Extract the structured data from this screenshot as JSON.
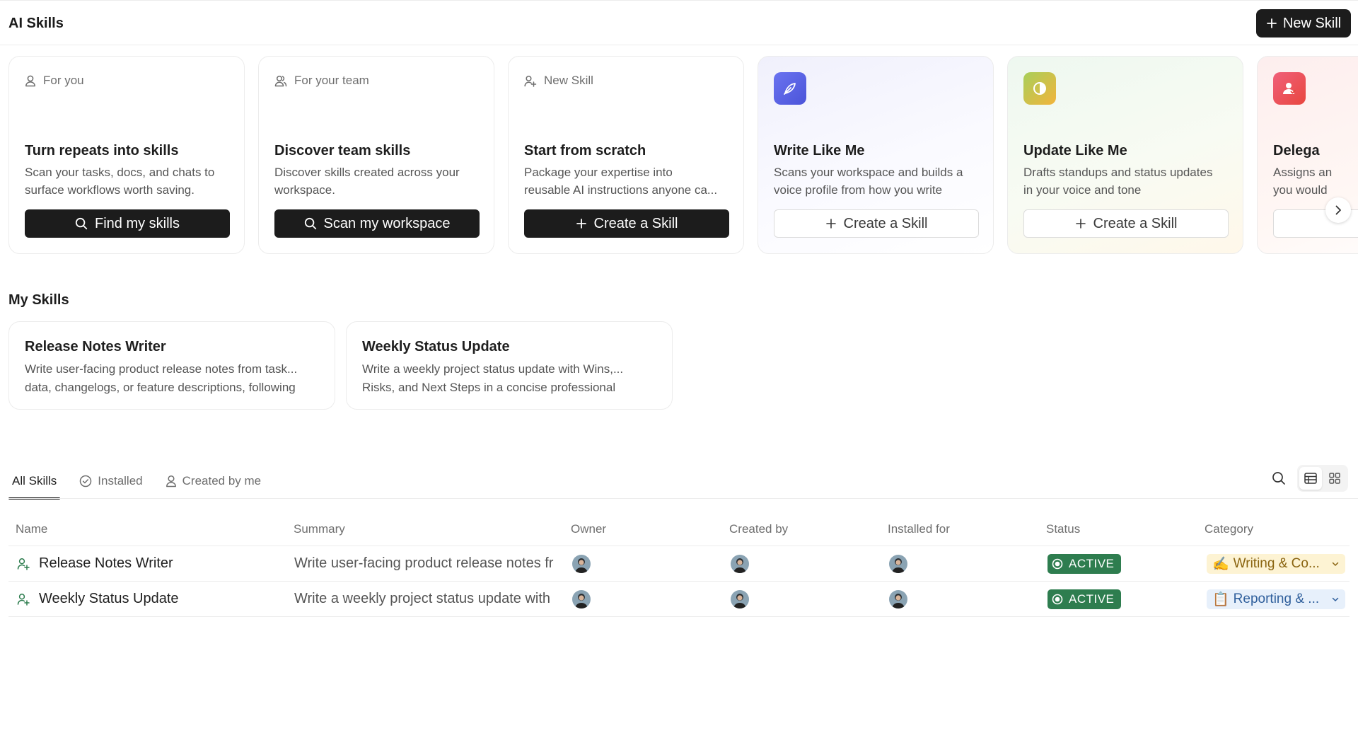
{
  "header": {
    "title": "AI Skills",
    "new_skill_label": "New Skill"
  },
  "feature_cards": [
    {
      "eyebrow": "For you",
      "title": "Turn repeats into skills",
      "desc_lines": [
        "Scan your tasks, docs, and chats to",
        "surface workflows worth saving."
      ],
      "button": "Find my skills"
    },
    {
      "eyebrow": "For your team",
      "title": "Discover team skills",
      "desc_lines": [
        "Discover skills created across your",
        "workspace."
      ],
      "button": "Scan my workspace"
    },
    {
      "eyebrow": "New Skill",
      "title": "Start from scratch",
      "desc_lines": [
        "Package your expertise into",
        "reusable AI instructions anyone ca..."
      ],
      "button": "Create a Skill"
    },
    {
      "title": "Write Like Me",
      "desc_lines": [
        "Scans your workspace and builds a",
        "voice profile from how you write"
      ],
      "button": "Create a Skill"
    },
    {
      "title": "Update Like Me",
      "desc_lines": [
        "Drafts standups and status updates",
        "in your voice and tone"
      ],
      "button": "Create a Skill"
    },
    {
      "title": "Delega",
      "desc_lines": [
        "Assigns an",
        "you would"
      ],
      "button": ""
    }
  ],
  "my_skills": {
    "title": "My Skills",
    "items": [
      {
        "title": "Release Notes Writer",
        "desc_lines": [
          "Write user-facing product release notes from task...",
          "data, changelogs, or feature descriptions, following"
        ]
      },
      {
        "title": "Weekly Status Update",
        "desc_lines": [
          "Write a weekly project status update with Wins,...",
          "Risks, and Next Steps in a concise professional"
        ]
      }
    ]
  },
  "tabs": [
    {
      "label": "All Skills"
    },
    {
      "label": "Installed"
    },
    {
      "label": "Created by me"
    }
  ],
  "table": {
    "columns": [
      "Name",
      "Summary",
      "Owner",
      "Created by",
      "Installed for",
      "Status",
      "Category"
    ],
    "rows": [
      {
        "name": "Release Notes Writer",
        "summary": "Write user-facing product release notes fr",
        "status": "ACTIVE",
        "category": "Writing & Co...",
        "category_emoji": "✍️"
      },
      {
        "name": "Weekly Status Update",
        "summary": "Write a weekly project status update with",
        "status": "ACTIVE",
        "category": "Reporting & ...",
        "category_emoji": "📋"
      }
    ]
  },
  "colors": {
    "accent_dark": "#1c1c1c",
    "status_active": "#2e7d4f",
    "writing_bg": "#fdf3d3",
    "reporting_bg": "#e7f0fb"
  }
}
